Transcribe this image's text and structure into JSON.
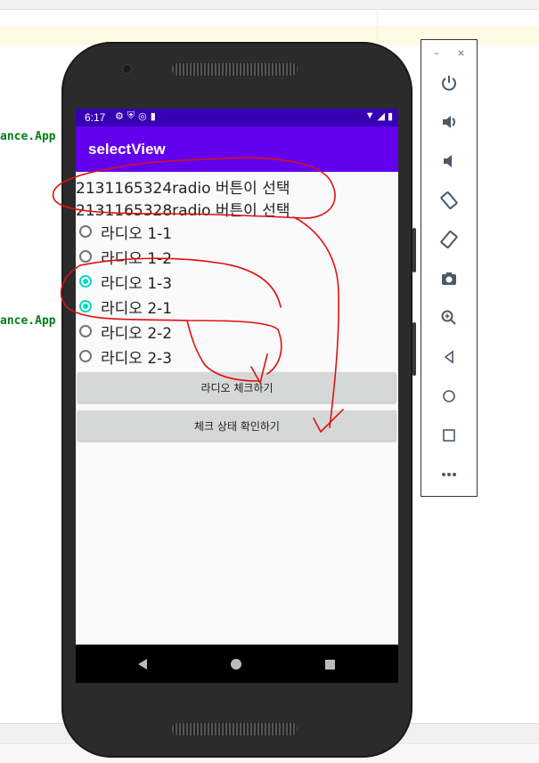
{
  "ide": {
    "code_lines": [
      "ance.App",
      "ance.App"
    ]
  },
  "statusbar": {
    "time": "6:17"
  },
  "app": {
    "title": "selectView"
  },
  "selections": [
    "2131165324radio 버튼이 선택",
    "2131165328radio 버튼이 선택"
  ],
  "radios": [
    {
      "label": "라디오 1-1",
      "checked": false
    },
    {
      "label": "라디오 1-2",
      "checked": false
    },
    {
      "label": "라디오 1-3",
      "checked": true
    },
    {
      "label": "라디오 2-1",
      "checked": true
    },
    {
      "label": "라디오 2-2",
      "checked": false
    },
    {
      "label": "라디오 2-3",
      "checked": false
    }
  ],
  "buttons": {
    "check_radio": "라디오 체크하기",
    "check_state": "체크 상태 확인하기"
  },
  "emulator": {
    "minimize": "–",
    "close": "×",
    "tools": [
      "power-icon",
      "volume-up-icon",
      "volume-down-icon",
      "rotate-left-icon",
      "rotate-right-icon",
      "camera-icon",
      "zoom-icon",
      "back-icon",
      "home-icon",
      "overview-icon",
      "more-icon"
    ]
  },
  "colors": {
    "status_bar": "#3700b3",
    "app_bar": "#6200ee",
    "radio_checked": "#03dac5",
    "annotation": "#e01010"
  }
}
